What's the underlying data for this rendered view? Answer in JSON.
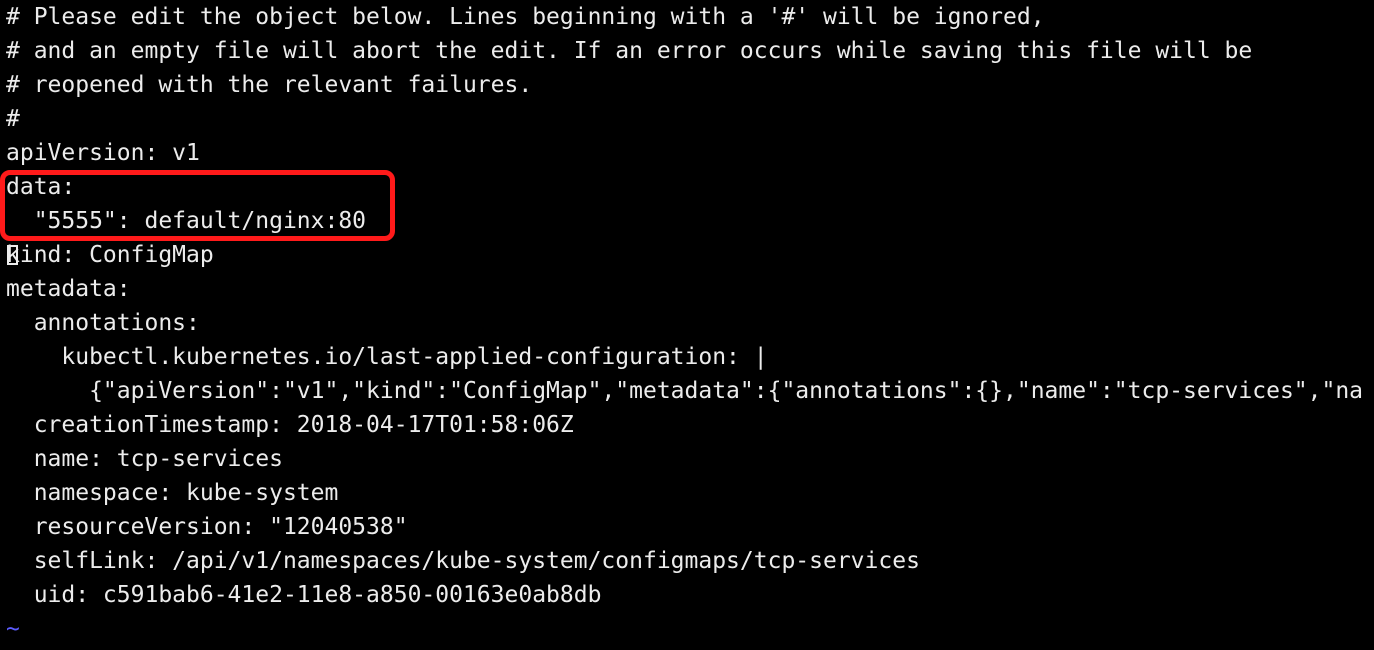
{
  "editor": {
    "lines": [
      "# Please edit the object below. Lines beginning with a '#' will be ignored,",
      "# and an empty file will abort the edit. If an error occurs while saving this file will be",
      "# reopened with the relevant failures.",
      "#",
      "apiVersion: v1",
      "data:",
      "  \"5555\": default/nginx:80",
      "kind: ConfigMap",
      "metadata:",
      "  annotations:",
      "    kubectl.kubernetes.io/last-applied-configuration: |",
      "      {\"apiVersion\":\"v1\",\"kind\":\"ConfigMap\",\"metadata\":{\"annotations\":{},\"name\":\"tcp-services\",\"na",
      "  creationTimestamp: 2018-04-17T01:58:06Z",
      "  name: tcp-services",
      "  namespace: kube-system",
      "  resourceVersion: \"12040538\"",
      "  selfLink: /api/v1/namespaces/kube-system/configmaps/tcp-services",
      "  uid: c591bab6-41e2-11e8-a850-00163e0ab8db"
    ],
    "empty_line_marker": "~"
  },
  "colors": {
    "background": "#000000",
    "text": "#ececec",
    "tilde": "#5c5cff",
    "highlight": "#ff1a1a"
  }
}
